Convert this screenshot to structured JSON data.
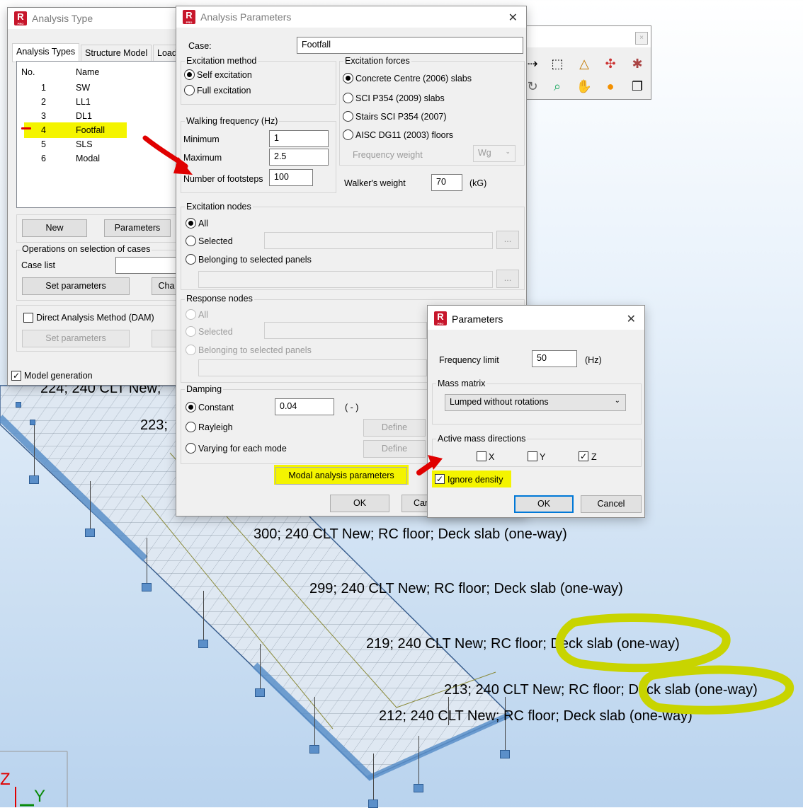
{
  "analysis_type": {
    "title": "Analysis Type",
    "tabs": [
      "Analysis Types",
      "Structure Model",
      "Load"
    ],
    "columns": {
      "no": "No.",
      "name": "Name"
    },
    "cases": [
      {
        "no": "1",
        "name": "SW"
      },
      {
        "no": "2",
        "name": "LL1"
      },
      {
        "no": "3",
        "name": "DL1"
      },
      {
        "no": "4",
        "name": "Footfall"
      },
      {
        "no": "5",
        "name": "SLS"
      },
      {
        "no": "6",
        "name": "Modal"
      }
    ],
    "new_btn": "New",
    "parameters_btn": "Parameters",
    "ops_label": "Operations on selection of cases",
    "case_list_label": "Case list",
    "set_params_btn": "Set parameters",
    "change_btn": "Cha",
    "dam_label": "Direct Analysis Method (DAM)",
    "dam_set_btn": "Set parameters",
    "model_gen_label": "Model generation",
    "model_gen_checked": "✓"
  },
  "analysis_params": {
    "title": "Analysis Parameters",
    "case_label": "Case:",
    "case_value": "Footfall",
    "excitation_method_label": "Excitation method",
    "self_excitation": "Self excitation",
    "full_excitation": "Full excitation",
    "excitation_forces_label": "Excitation forces",
    "forces": [
      "Concrete Centre (2006) slabs",
      "SCI P354 (2009) slabs",
      "Stairs SCI P354 (2007)",
      "AISC DG11 (2003) floors"
    ],
    "frequency_weight_label": "Frequency weight",
    "frequency_weight_value": "Wg",
    "walking_label": "Walking frequency (Hz)",
    "min_label": "Minimum",
    "min_value": "1",
    "max_label": "Maximum",
    "max_value": "2.5",
    "footsteps_label": "Number of footsteps",
    "footsteps_value": "100",
    "walker_weight_label": "Walker's weight",
    "walker_weight_value": "70",
    "walker_weight_unit": "(kG)",
    "excitation_nodes_label": "Excitation nodes",
    "all_label": "All",
    "selected_label": "Selected",
    "belonging_label": "Belonging to selected panels",
    "ellipsis": "...",
    "response_nodes_label": "Response nodes",
    "damping_label": "Damping",
    "constant_label": "Constant",
    "constant_value": "0.04",
    "constant_unit": "( - )",
    "rayleigh_label": "Rayleigh",
    "varying_label": "Varying for each mode",
    "define_btn": "Define",
    "modal_btn": "Modal analysis parameters",
    "ok_btn": "OK",
    "cancel_btn": "Cance"
  },
  "parameters": {
    "title": "Parameters",
    "freq_limit_label": "Frequency limit",
    "freq_limit_value": "50",
    "freq_unit": "(Hz)",
    "mass_matrix_label": "Mass matrix",
    "mass_matrix_value": "Lumped without rotations",
    "active_mass_label": "Active mass directions",
    "x_label": "X",
    "y_label": "Y",
    "z_label": "Z",
    "z_checked": "✓",
    "ignore_density_label": "Ignore density",
    "ignore_density_checked": "✓",
    "ok_btn": "OK",
    "cancel_btn": "Cancel"
  },
  "model_labels": [
    "224; 240 CLT New;",
    "223;",
    "300; 240 CLT New; RC floor; Deck slab (one-way)",
    "299; 240 CLT New; RC floor; Deck slab (one-way)",
    "219; 240 CLT New; RC floor; Deck slab (one-way)",
    "213; 240 CLT New; RC floor; Deck slab (one-way)",
    "212; 240 CLT New; RC floor; Deck slab (one-way)"
  ],
  "axis_labels": {
    "z": "Z",
    "y": "Y"
  },
  "toolbar_icons": [
    "axes-icon",
    "frame-icon",
    "truss-icon",
    "molecule-icon",
    "bug-icon",
    "rotate-icon",
    "zoom-icon",
    "pan-hand-icon",
    "sphere-icon",
    "layers-icon"
  ],
  "colors": {
    "highlight": "#f4f400",
    "annotation_red": "#e00000",
    "accent": "#0078d7",
    "logo": "#c7162b"
  }
}
